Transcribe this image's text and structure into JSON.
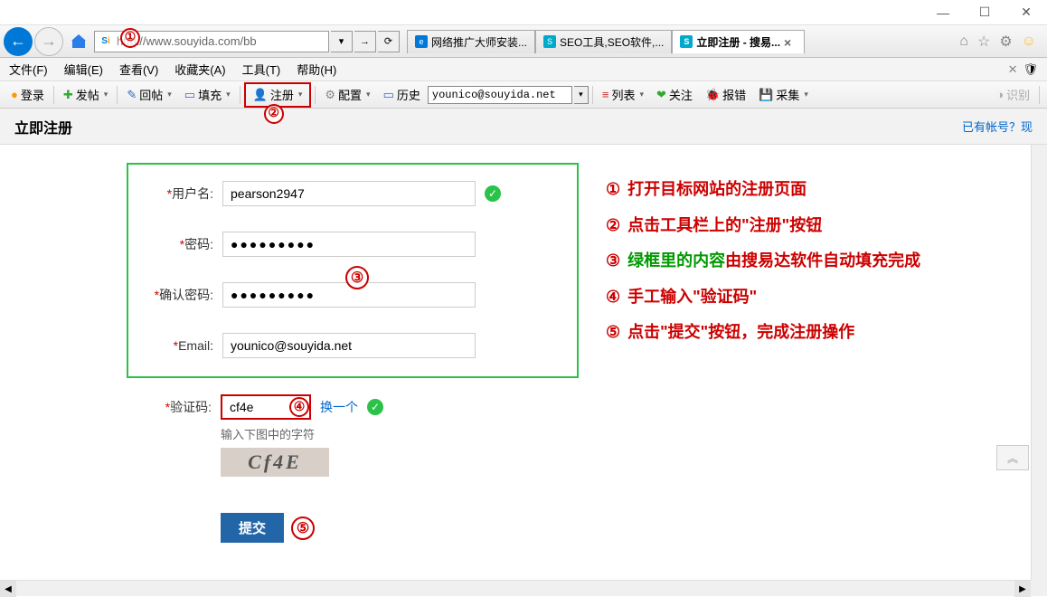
{
  "window": {
    "min": "—",
    "max": "☐",
    "close": "✕"
  },
  "nav": {
    "url": "ttp://www.souyida.com/bb",
    "tabs": [
      {
        "label": "网络推广大师安装...",
        "icon_bg": "#0078d7",
        "icon": "e"
      },
      {
        "label": "SEO工具,SEO软件,...",
        "icon_bg": "#0ac",
        "icon": "S"
      },
      {
        "label": "立即注册 - 搜易...",
        "icon_bg": "#0ac",
        "icon": "S",
        "active": true
      }
    ]
  },
  "menu": {
    "file": "文件(F)",
    "edit": "编辑(E)",
    "view": "查看(V)",
    "fav": "收藏夹(A)",
    "tool": "工具(T)",
    "help": "帮助(H)"
  },
  "toolbar": {
    "login": "登录",
    "post": "发帖",
    "reply": "回帖",
    "fill": "填充",
    "register": "注册",
    "config": "配置",
    "history": "历史",
    "email_value": "younico@souyida.net",
    "list": "列表",
    "follow": "关注",
    "bug": "报错",
    "collect": "采集",
    "detect": "识别"
  },
  "page": {
    "title": "立即注册",
    "has_account": "已有帐号？现"
  },
  "form": {
    "username_label": "用户名:",
    "username_value": "pearson2947",
    "password_label": "密码:",
    "password_value": "●●●●●●●●●",
    "confirm_label": "确认密码:",
    "confirm_value": "●●●●●●●●●",
    "email_label": "Email:",
    "email_value": "younico@souyida.net",
    "captcha_label": "验证码:",
    "captcha_value": "cf4e",
    "captcha_change": "换一个",
    "captcha_hint": "输入下图中的字符",
    "captcha_img": "Cf4E",
    "submit": "提交"
  },
  "annotations": {
    "a1": "①",
    "a2": "②",
    "a3": "③",
    "a4": "④",
    "a5": "⑤"
  },
  "instructions": {
    "l1_num": "①",
    "l1": "打开目标网站的注册页面",
    "l2_num": "②",
    "l2": "点击工具栏上的\"注册\"按钮",
    "l3_num": "③",
    "l3a": "绿框里的内容",
    "l3b": "由搜易达软件自动填充完成",
    "l4_num": "④",
    "l4": "手工输入\"验证码\"",
    "l5_num": "⑤",
    "l5": "点击\"提交\"按钮，完成注册操作"
  }
}
